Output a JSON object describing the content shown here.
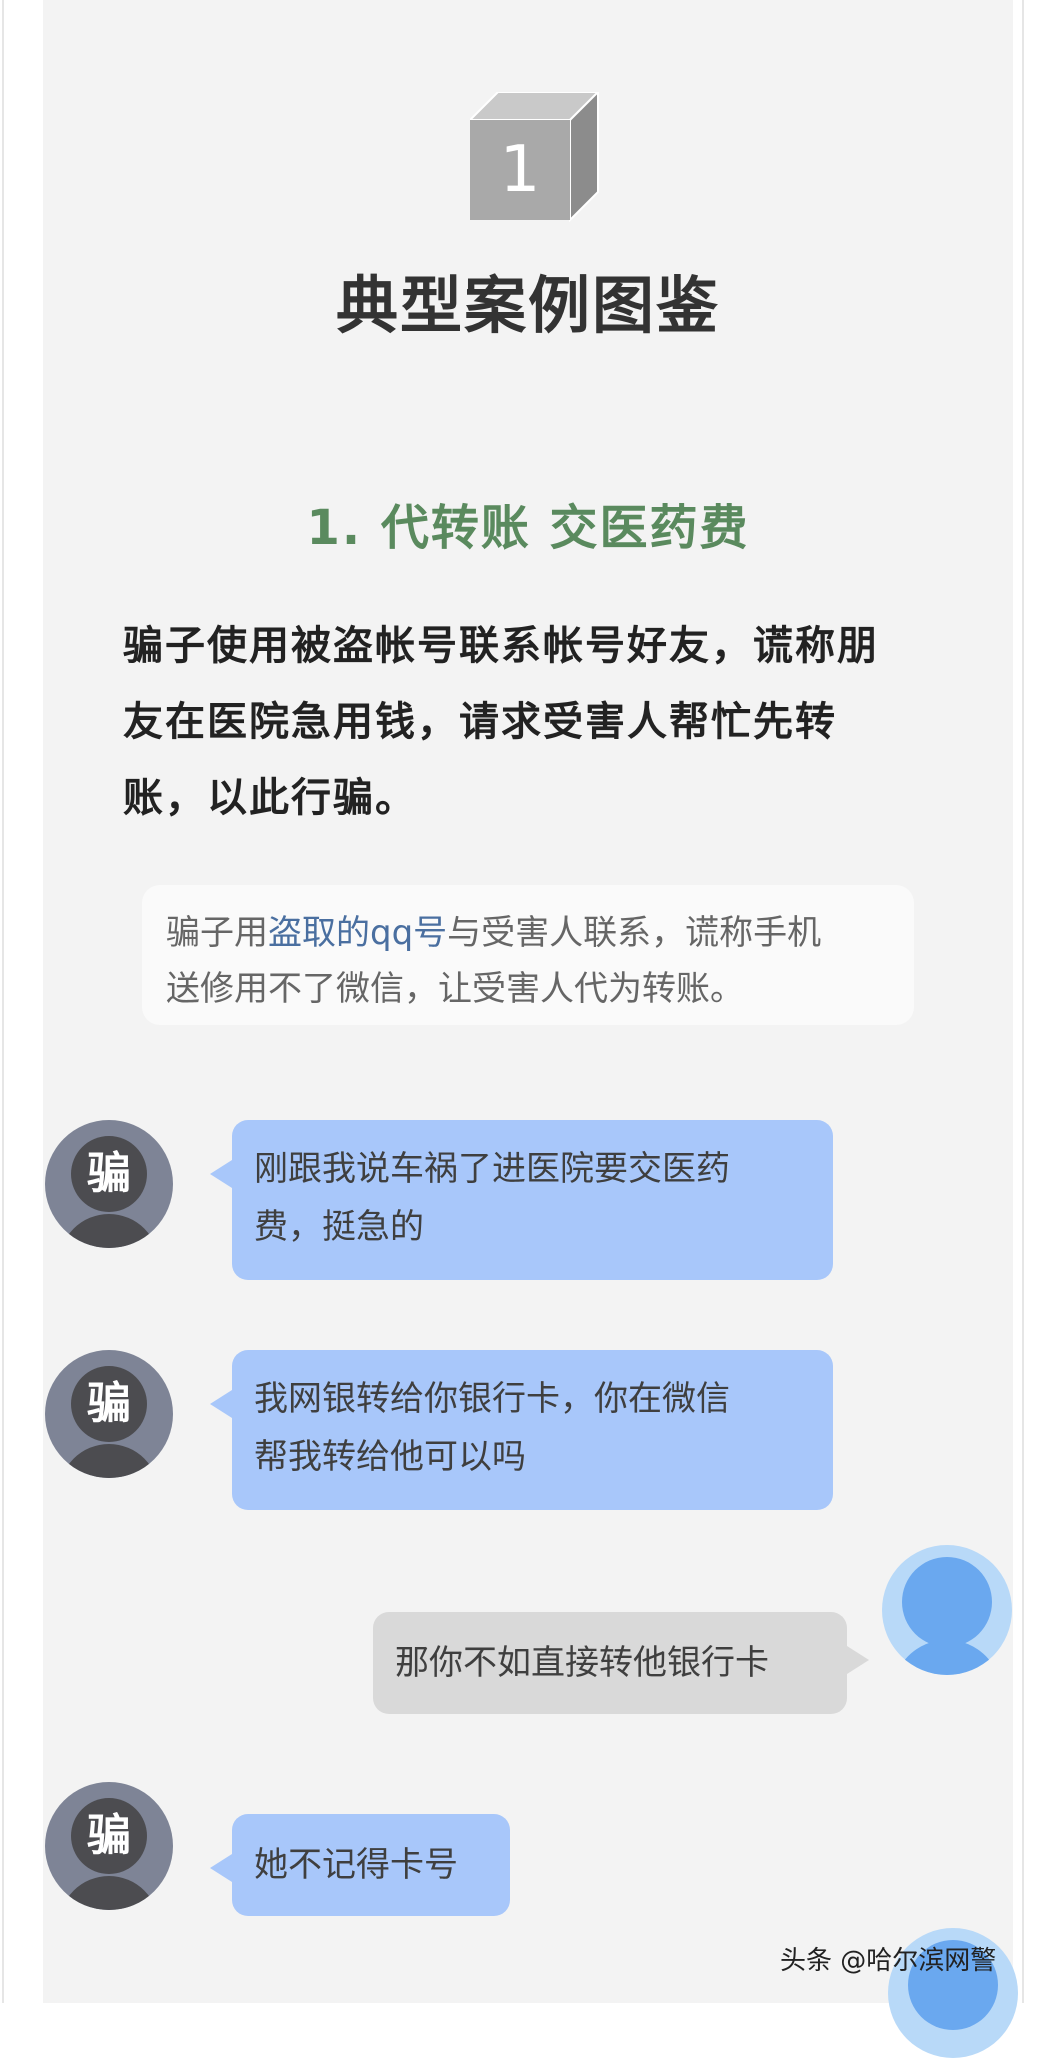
{
  "section": {
    "number": "1",
    "title": "典型案例图鉴"
  },
  "case": {
    "title": "1. 代转账 交医药费",
    "description_lines": [
      "骗子使用被盗帐号联系帐号好友，谎称朋",
      "友在医院急用钱，请求受害人帮忙先转",
      "账，以此行骗。"
    ],
    "note": {
      "line1_before": "骗子用",
      "line1_highlight": "盗取的qq号",
      "line1_after": "与受害人联系，谎称手机",
      "line2": "送修用不了微信，让受害人代为转账。"
    }
  },
  "chat": {
    "scammer_avatar_char": "骗",
    "messages": [
      {
        "sender": "scammer",
        "lines": [
          "刚跟我说车祸了进医院要交医药",
          "费，挺急的"
        ]
      },
      {
        "sender": "scammer",
        "lines": [
          "我网银转给你银行卡，你在微信",
          "帮我转给他可以吗"
        ]
      },
      {
        "sender": "victim",
        "lines": [
          "那你不如直接转他银行卡"
        ]
      },
      {
        "sender": "scammer",
        "lines": [
          "她不记得卡号"
        ]
      }
    ]
  },
  "watermark": "头条 @哈尔滨网警",
  "colors": {
    "case_title": "#5a8a5e",
    "note_highlight": "#4a6fa0",
    "scammer_bubble": "#a8c7fa",
    "victim_bubble": "#d9d9d9",
    "victim_avatar": "#6aa8ef"
  }
}
